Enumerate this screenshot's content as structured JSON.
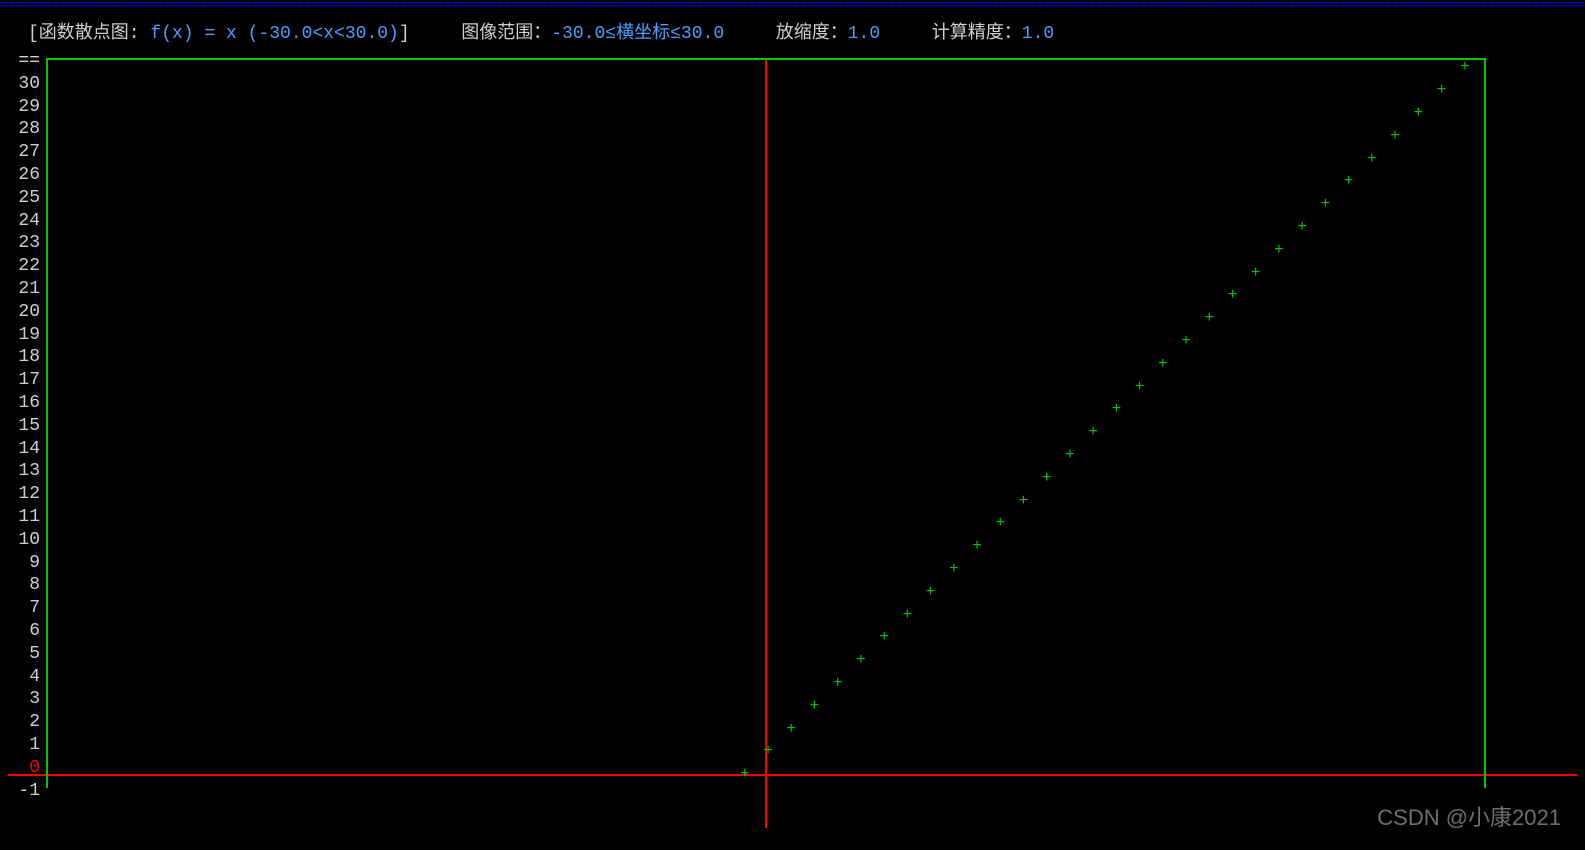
{
  "header": {
    "label_prefix": "[函数散点图: ",
    "function_text": "f(x) = x (-30.0<x<30.0)",
    "label_suffix": "]",
    "range_label": "图像范围：",
    "range_value": "-30.0≤横坐标≤30.0",
    "zoom_label": "放缩度：",
    "zoom_value": "1.0",
    "precision_label": "计算精度：",
    "precision_value": "1.0"
  },
  "chart_data": {
    "type": "scatter",
    "title": "函数散点图 f(x) = x",
    "function": "f(x) = x",
    "x_domain": [
      -30.0,
      30.0
    ],
    "visible_y_labels": [
      "==",
      30,
      29,
      28,
      27,
      26,
      25,
      24,
      23,
      22,
      21,
      20,
      19,
      18,
      17,
      16,
      15,
      14,
      13,
      12,
      11,
      10,
      9,
      8,
      7,
      6,
      5,
      4,
      3,
      2,
      1,
      0,
      -1
    ],
    "x_range": [
      -31,
      31
    ],
    "y_visible_range": [
      -1,
      30
    ],
    "zero_y_index": 31,
    "x_axis_center_fraction": 0.5,
    "points": [
      {
        "x": 0,
        "y": 0
      },
      {
        "x": 1,
        "y": 1
      },
      {
        "x": 2,
        "y": 2
      },
      {
        "x": 3,
        "y": 3
      },
      {
        "x": 4,
        "y": 4
      },
      {
        "x": 5,
        "y": 5
      },
      {
        "x": 6,
        "y": 6
      },
      {
        "x": 7,
        "y": 7
      },
      {
        "x": 8,
        "y": 8
      },
      {
        "x": 9,
        "y": 9
      },
      {
        "x": 10,
        "y": 10
      },
      {
        "x": 11,
        "y": 11
      },
      {
        "x": 12,
        "y": 12
      },
      {
        "x": 13,
        "y": 13
      },
      {
        "x": 14,
        "y": 14
      },
      {
        "x": 15,
        "y": 15
      },
      {
        "x": 16,
        "y": 16
      },
      {
        "x": 17,
        "y": 17
      },
      {
        "x": 18,
        "y": 18
      },
      {
        "x": 19,
        "y": 19
      },
      {
        "x": 20,
        "y": 20
      },
      {
        "x": 21,
        "y": 21
      },
      {
        "x": 22,
        "y": 22
      },
      {
        "x": 23,
        "y": 23
      },
      {
        "x": 24,
        "y": 24
      },
      {
        "x": 25,
        "y": 25
      },
      {
        "x": 26,
        "y": 26
      },
      {
        "x": 27,
        "y": 27
      },
      {
        "x": 28,
        "y": 28
      },
      {
        "x": 29,
        "y": 29
      },
      {
        "x": 30,
        "y": 30
      },
      {
        "x": -1,
        "y": -1
      }
    ],
    "point_glyph": "+"
  },
  "watermark": "CSDN @小康2021"
}
